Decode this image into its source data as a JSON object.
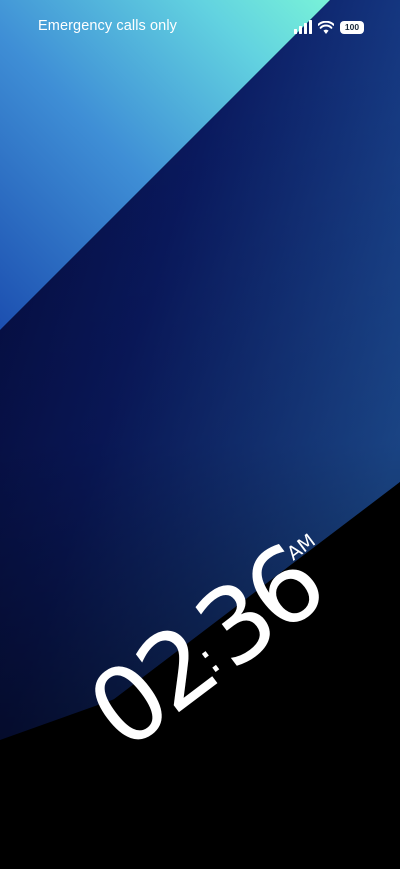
{
  "status_bar": {
    "carrier_text": "Emergency calls only",
    "battery_level": "100",
    "signal_bars": 4,
    "icons": [
      "signal-icon",
      "wifi-icon",
      "battery-icon"
    ]
  },
  "lock_screen": {
    "hours": "02",
    "separator": ":",
    "minutes": "36",
    "meridiem": "AM"
  },
  "colors": {
    "background": "#000000",
    "teal": "#6ff0d8",
    "light_blue": "#4aa0e0",
    "mid_blue": "#1a4aa8",
    "navy": "#0a1a5a",
    "text": "#ffffff"
  }
}
